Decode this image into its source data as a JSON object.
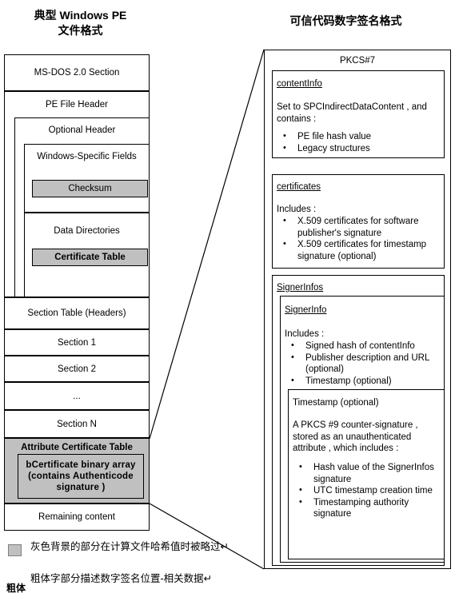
{
  "titles": {
    "left": "典型 Windows PE\n文件格式",
    "right": "可信代码数字签名格式"
  },
  "pe_layout": {
    "rows": [
      {
        "label": "MS-DOS  2.0 Section",
        "gray": false,
        "bold": false
      },
      {
        "label": "PE File Header",
        "gray": false,
        "bold": false
      },
      {
        "label": "Optional Header",
        "gray": false,
        "bold": false
      },
      {
        "label": "Windows‑Specific Fields",
        "gray": false,
        "bold": false
      },
      {
        "label": "Checksum",
        "gray": true,
        "bold": false
      },
      {
        "label": "Data Directories",
        "gray": false,
        "bold": false
      },
      {
        "label": "Certificate Table",
        "gray": true,
        "bold": true
      },
      {
        "label": "Section Table  (Headers)",
        "gray": false,
        "bold": false
      },
      {
        "label": "Section 1",
        "gray": false,
        "bold": false
      },
      {
        "label": "Section 2",
        "gray": false,
        "bold": false
      },
      {
        "label": "...",
        "gray": false,
        "bold": false
      },
      {
        "label": "Section N",
        "gray": false,
        "bold": false
      },
      {
        "label": "Attribute Certificate Table",
        "gray": true,
        "bold": true
      },
      {
        "label": "bCertificate binary array\n(contains Authenticode\nsignature )",
        "gray": true,
        "bold": true
      },
      {
        "label": "Remaining content",
        "gray": false,
        "bold": false
      }
    ]
  },
  "pkcs7": {
    "title": "PKCS#7",
    "content_info": {
      "title": "contentInfo",
      "intro": "Set to SPCIndirectDataContent   , and contains :",
      "bullets": [
        "PE file hash value",
        "Legacy structures"
      ]
    },
    "certificates": {
      "title": "certificates",
      "intro": "Includes :",
      "bullets": [
        "X.509 certificates for software publisher's signature",
        "X.509 certificates for timestamp signature (optional)"
      ]
    },
    "signer_infos": {
      "title": "SignerInfos",
      "signer_info": {
        "title": "SignerInfo",
        "intro": "Includes :",
        "bullets": [
          "Signed hash of contentInfo",
          "Publisher description and URL (optional)",
          "Timestamp (optional)"
        ],
        "timestamp": {
          "title": "Timestamp (optional)",
          "intro": "A PKCS #9 counter‑signature , stored as an unauthenticated attribute , which includes :",
          "bullets": [
            "Hash value of the SignerInfos signature",
            "UTC timestamp creation time",
            "Timestamping authority signature"
          ]
        }
      }
    }
  },
  "legend": {
    "gray_key": "gray-swatch",
    "gray_text": "灰色背景的部分在计算文件哈希值时被略过↵",
    "bold_key": "粗体",
    "bold_text": "粗体字部分描述数字签名位置-相关数据↵"
  },
  "colors": {
    "gray_fill": "#c0c0c0",
    "border": "#000000",
    "background": "#ffffff"
  }
}
